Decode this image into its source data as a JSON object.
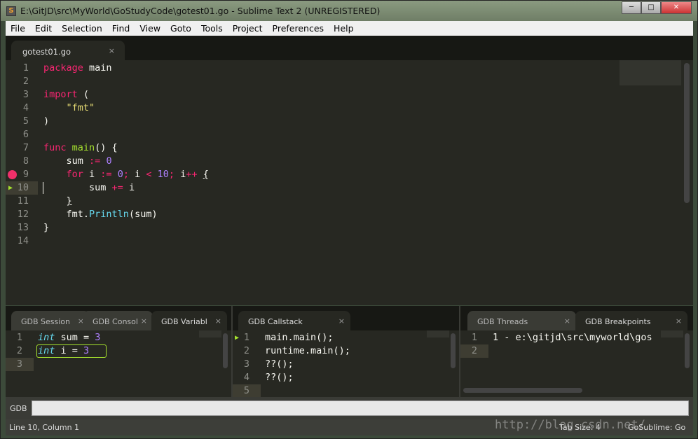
{
  "window": {
    "title": "E:\\GitJD\\src\\MyWorld\\GoStudyCode\\gotest01.go - Sublime Text 2 (UNREGISTERED)",
    "icon": "S",
    "minimize": "─",
    "maximize": "□",
    "close": "✕"
  },
  "menu": [
    "File",
    "Edit",
    "Selection",
    "Find",
    "View",
    "Goto",
    "Tools",
    "Project",
    "Preferences",
    "Help"
  ],
  "editor": {
    "tab": {
      "label": "gotest01.go",
      "close": "×"
    },
    "breakpoint_line": 9,
    "current_line": 10,
    "current_marker": "▶",
    "lines": [
      [
        [
          "package",
          "k"
        ],
        [
          " main",
          ""
        ]
      ],
      [],
      [
        [
          "import",
          "k"
        ],
        [
          " (",
          ""
        ]
      ],
      [
        [
          "    ",
          ""
        ],
        [
          "\"fmt\"",
          "s"
        ]
      ],
      [
        [
          ")",
          ""
        ]
      ],
      [],
      [
        [
          "func",
          "k"
        ],
        [
          " ",
          ""
        ],
        [
          "main",
          "f"
        ],
        [
          "() {",
          ""
        ]
      ],
      [
        [
          "    sum ",
          ""
        ],
        [
          ":=",
          "k"
        ],
        [
          " ",
          ""
        ],
        [
          "0",
          "n"
        ]
      ],
      [
        [
          "    ",
          ""
        ],
        [
          "for",
          "k"
        ],
        [
          " i ",
          ""
        ],
        [
          ":=",
          "k"
        ],
        [
          " ",
          ""
        ],
        [
          "0",
          "n"
        ],
        [
          ";",
          "k"
        ],
        [
          " i ",
          ""
        ],
        [
          "<",
          "k"
        ],
        [
          " ",
          ""
        ],
        [
          "10",
          "n"
        ],
        [
          ";",
          "k"
        ],
        [
          " i",
          ""
        ],
        [
          "++",
          "k"
        ],
        [
          " ",
          ""
        ],
        [
          "{",
          "u"
        ]
      ],
      [
        [
          "        sum ",
          ""
        ],
        [
          "+=",
          "k"
        ],
        [
          " i",
          ""
        ]
      ],
      [
        [
          "    ",
          ""
        ],
        [
          "}",
          "u"
        ]
      ],
      [
        [
          "    fmt.",
          ""
        ],
        [
          "Println",
          "t2"
        ],
        [
          "(sum)",
          ""
        ]
      ],
      [
        [
          "}",
          ""
        ]
      ],
      []
    ]
  },
  "panes": [
    {
      "tabs": [
        {
          "label": "GDB Session",
          "close": "×"
        },
        {
          "label": "GDB Consol",
          "close": "×"
        },
        {
          "label": "GDB Variabl",
          "close": "×",
          "active": true
        }
      ],
      "lines": [
        [
          [
            "int",
            "t"
          ],
          [
            " sum = ",
            ""
          ],
          [
            "3",
            "n"
          ]
        ],
        [
          [
            "int",
            "t"
          ],
          [
            " i = ",
            ""
          ],
          [
            "3",
            "n"
          ]
        ],
        []
      ]
    },
    {
      "tabs": [
        {
          "label": "GDB Callstack",
          "close": "×",
          "active": true
        }
      ],
      "lines": [
        [
          [
            "main.main();",
            ""
          ]
        ],
        [
          [
            "runtime.main();",
            ""
          ]
        ],
        [
          [
            "??();",
            ""
          ]
        ],
        [
          [
            "??();",
            ""
          ]
        ],
        []
      ]
    },
    {
      "tabs": [
        {
          "label": "GDB Threads",
          "close": "×"
        },
        {
          "label": "GDB Breakpoints",
          "close": "×",
          "active": true
        }
      ],
      "lines": [
        [
          [
            "1 - e:\\gitjd\\src\\myworld\\gos",
            ""
          ]
        ],
        []
      ]
    }
  ],
  "gdb_input": {
    "label": "GDB",
    "value": ""
  },
  "status": {
    "position": "Line 10, Column 1",
    "tab_size": "Tab Size: 4",
    "syntax": "GoSublime: Go"
  },
  "watermark": "http://blog.csdn.net/"
}
